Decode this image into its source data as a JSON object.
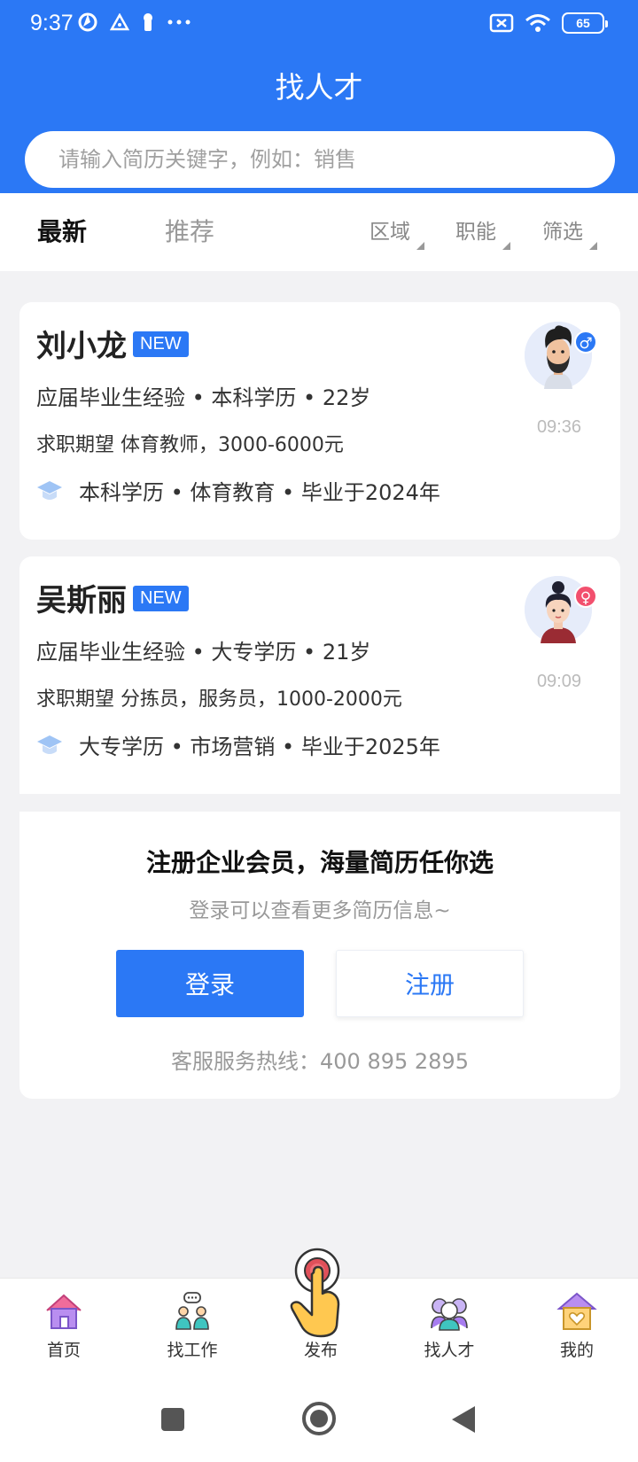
{
  "status_bar": {
    "time": "9:37",
    "battery": "65"
  },
  "header": {
    "title": "找人才",
    "search_placeholder": "请输入简历关键字，例如：销售"
  },
  "tabs": {
    "latest": "最新",
    "recommend": "推荐"
  },
  "filters": {
    "region": "区域",
    "function": "职能",
    "screen": "筛选"
  },
  "candidates": [
    {
      "name": "刘小龙",
      "badge": "NEW",
      "meta": "应届毕业生经验 • 本科学历 • 22岁",
      "expectation": "求职期望 体育教师，3000-6000元",
      "education": "本科学历 • 体育教育 • 毕业于2024年",
      "time": "09:36",
      "gender": "♂",
      "gender_color": "#2b78f5"
    },
    {
      "name": "吴斯丽",
      "badge": "NEW",
      "meta": "应届毕业生经验 • 大专学历 • 21岁",
      "expectation": "求职期望 分拣员，服务员，1000-2000元",
      "education": "大专学历 • 市场营销 • 毕业于2025年",
      "time": "09:09",
      "gender": "♀",
      "gender_color": "#f2506e"
    }
  ],
  "cta": {
    "title": "注册企业会员，海量简历任你选",
    "subtitle": "登录可以查看更多简历信息~",
    "login_label": "登录",
    "register_label": "注册",
    "hotline": "客服服务热线：400 895 2895"
  },
  "bottom_nav": {
    "home": "首页",
    "find_job": "找工作",
    "publish": "发布",
    "find_talent": "找人才",
    "mine": "我的"
  },
  "colors": {
    "primary": "#2b78f5",
    "background": "#f2f2f4"
  }
}
